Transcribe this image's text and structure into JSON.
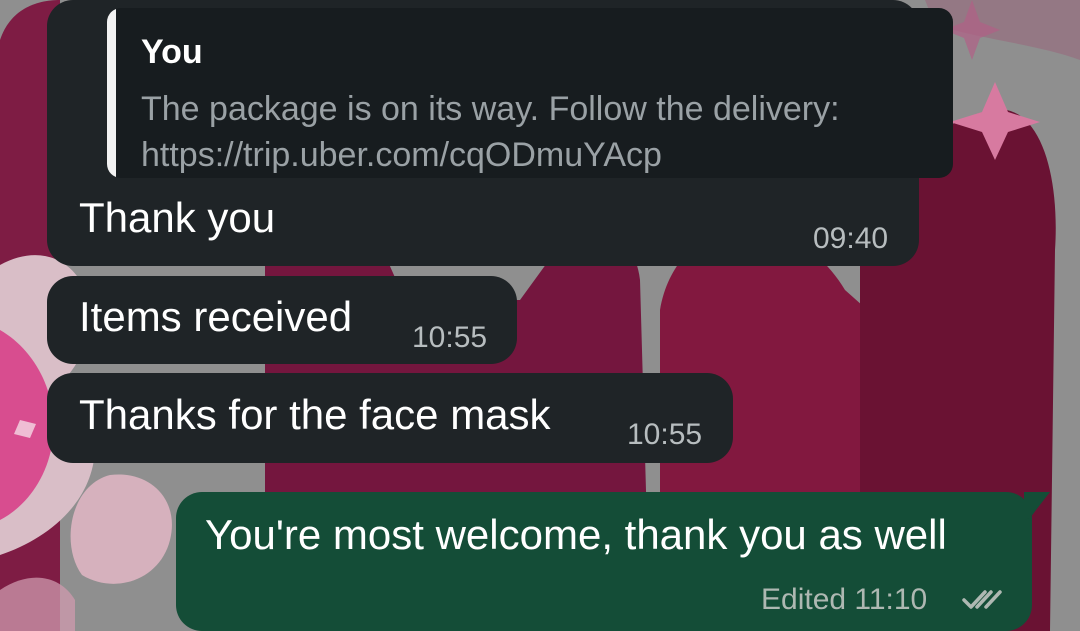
{
  "messages": [
    {
      "quote": {
        "author": "You",
        "text": "The package is on its way. Follow the delivery: https://trip.uber.com/cqODmuYAcp"
      },
      "text": "Thank you",
      "time": "09:40"
    },
    {
      "text": "Items received",
      "time": "10:55"
    },
    {
      "text": "Thanks for the face mask",
      "time": "10:55"
    },
    {
      "text": "You're most welcome, thank you as well",
      "status": "Edited 11:10",
      "icon": "double-check-icon"
    }
  ],
  "colors": {
    "incoming_bubble": "#1f2427",
    "outgoing_bubble": "#144d37",
    "wallpaper_base": "#8f8f8f",
    "wallpaper_accent": "#7d1640"
  }
}
